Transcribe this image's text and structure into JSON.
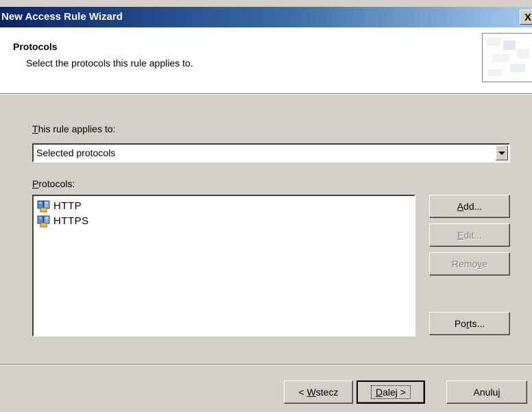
{
  "window": {
    "title": "New Access Rule Wizard",
    "close_glyph": "X"
  },
  "header": {
    "title": "Protocols",
    "subtitle": "Select the protocols this rule applies to."
  },
  "applies": {
    "label_accel": "T",
    "label_rest": "his rule applies to:",
    "selected_value": "Selected protocols"
  },
  "protocols": {
    "label_accel": "P",
    "label_rest": "rotocols:",
    "items": [
      {
        "name": "HTTP",
        "icon": "protocol-icon"
      },
      {
        "name": "HTTPS",
        "icon": "protocol-icon"
      }
    ]
  },
  "side_buttons": {
    "add_accel": "A",
    "add_rest": "dd...",
    "edit_accel": "E",
    "edit_rest": "dit...",
    "remove_pre": "Remo",
    "remove_accel": "v",
    "remove_post": "e",
    "ports_pre": "Po",
    "ports_accel": "r",
    "ports_post": "ts..."
  },
  "footer": {
    "back_pre": "< ",
    "back_accel": "W",
    "back_post": "stecz",
    "next_accel": "D",
    "next_post": "alej >",
    "cancel": "Anuluj"
  },
  "colors": {
    "titlebar_start": "#0a246a",
    "titlebar_end": "#a6caf0",
    "face": "#d4d0c8",
    "disabled_text": "#808080"
  }
}
